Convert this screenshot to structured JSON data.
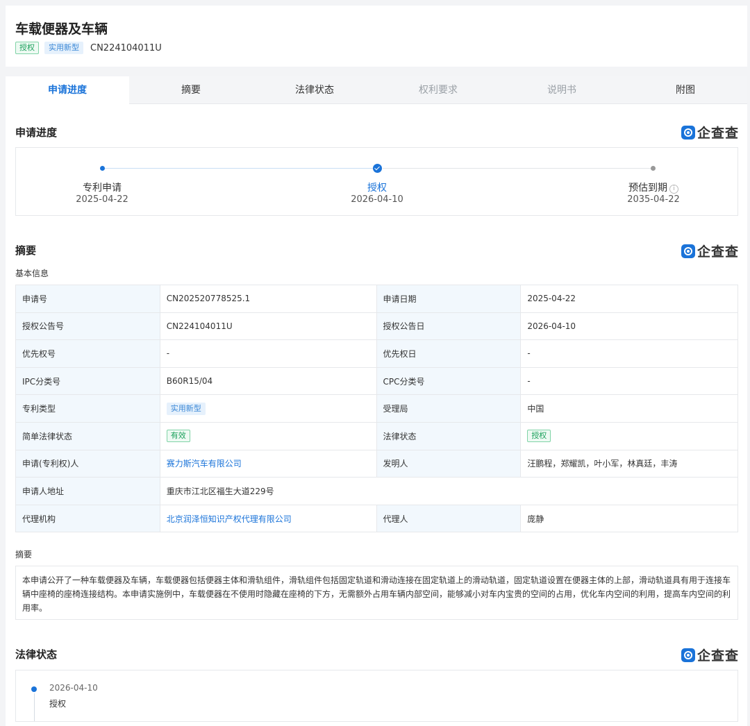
{
  "header": {
    "title": "车载便器及车辆",
    "tag_status": "授权",
    "tag_type": "实用新型",
    "pub_no": "CN224104011U"
  },
  "tabs": [
    {
      "label": "申请进度",
      "state": "active"
    },
    {
      "label": "摘要",
      "state": "normal"
    },
    {
      "label": "法律状态",
      "state": "normal"
    },
    {
      "label": "权利要求",
      "state": "disabled"
    },
    {
      "label": "说明书",
      "state": "disabled"
    },
    {
      "label": "附图",
      "state": "normal"
    }
  ],
  "brand": "企查查",
  "progress": {
    "title": "申请进度",
    "steps": [
      {
        "label": "专利申请",
        "date": "2025-04-22"
      },
      {
        "label": "授权",
        "date": "2026-04-10"
      },
      {
        "label": "预估到期",
        "date": "2035-04-22"
      }
    ]
  },
  "summary": {
    "title": "摘要",
    "basic_info_label": "基本信息",
    "rows": [
      {
        "k1": "申请号",
        "v1": "CN202520778525.1",
        "k2": "申请日期",
        "v2": "2025-04-22"
      },
      {
        "k1": "授权公告号",
        "v1": "CN224104011U",
        "k2": "授权公告日",
        "v2": "2026-04-10"
      },
      {
        "k1": "优先权号",
        "v1": "-",
        "k2": "优先权日",
        "v2": "-"
      },
      {
        "k1": "IPC分类号",
        "v1": "B60R15/04",
        "k2": "CPC分类号",
        "v2": "-"
      },
      {
        "k1": "专利类型",
        "v1": "实用新型",
        "k2": "受理局",
        "v2": "中国"
      },
      {
        "k1": "简单法律状态",
        "v1": "有效",
        "k2": "法律状态",
        "v2": "授权"
      },
      {
        "k1": "申请(专利权)人",
        "v1": "赛力斯汽车有限公司",
        "k2": "发明人",
        "v2": "汪鹏程，郑耀凯，叶小军，林真廷，丰涛"
      },
      {
        "k1": "申请人地址",
        "v1": "重庆市江北区福生大道229号"
      },
      {
        "k1": "代理机构",
        "v1": "北京润泽恒知识产权代理有限公司",
        "k2": "代理人",
        "v2": "庞静"
      }
    ],
    "abstract_label": "摘要",
    "abstract_text": "本申请公开了一种车载便器及车辆，车载便器包括便器主体和滑轨组件，滑轨组件包括固定轨道和滑动连接在固定轨道上的滑动轨道，固定轨道设置在便器主体的上部，滑动轨道具有用于连接车辆中座椅的座椅连接结构。本申请实施例中，车载便器在不使用时隐藏在座椅的下方，无需额外占用车辆内部空间，能够减小对车内宝贵的空间的占用，优化车内空间的利用，提高车内空间的利用率。"
  },
  "legal": {
    "title": "法律状态",
    "events": [
      {
        "date": "2026-04-10",
        "text": "授权"
      }
    ]
  },
  "colors": {
    "accent": "#1a73d9",
    "green": "#1aa05b",
    "key_bg": "#f2f8fd"
  }
}
